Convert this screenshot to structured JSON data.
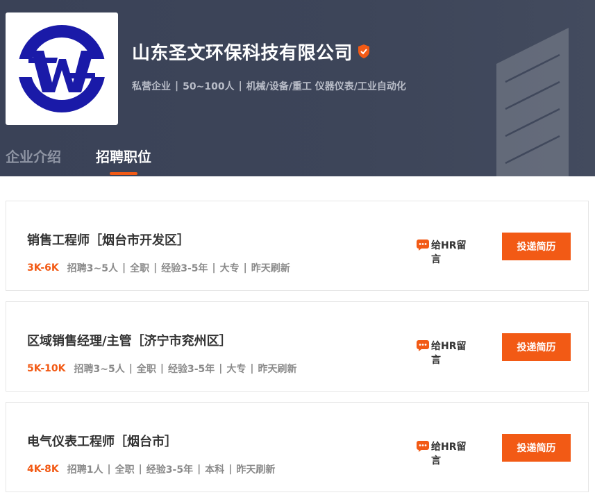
{
  "company": {
    "name": "山东圣文环保科技有限公司",
    "verified_icon": "verified-shield-icon",
    "meta": [
      "私营企业",
      "50~100人",
      "机械/设备/重工 仪器仪表/工业自动化"
    ],
    "logo_icon": "company-logo-sw"
  },
  "tabs": [
    {
      "label": "企业介绍",
      "active": false
    },
    {
      "label": "招聘职位",
      "active": true
    }
  ],
  "jobs": [
    {
      "title": "销售工程师［烟台市开发区］",
      "salary": "3K-6K",
      "details": [
        "招聘3~5人",
        "全职",
        "经验3-5年",
        "大专",
        "昨天刷新"
      ],
      "chat_label": "给HR留言",
      "apply_label": "投递简历"
    },
    {
      "title": "区域销售经理/主管［济宁市兖州区］",
      "salary": "5K-10K",
      "details": [
        "招聘3~5人",
        "全职",
        "经验3-5年",
        "大专",
        "昨天刷新"
      ],
      "chat_label": "给HR留言",
      "apply_label": "投递简历"
    },
    {
      "title": "电气仪表工程师［烟台市］",
      "salary": "4K-8K",
      "details": [
        "招聘1人",
        "全职",
        "经验3-5年",
        "本科",
        "昨天刷新"
      ],
      "chat_label": "给HR留言",
      "apply_label": "投递简历"
    }
  ],
  "colors": {
    "accent": "#f25a15",
    "header_bg": "#3d4559",
    "logo_blue": "#1a1aa8"
  }
}
